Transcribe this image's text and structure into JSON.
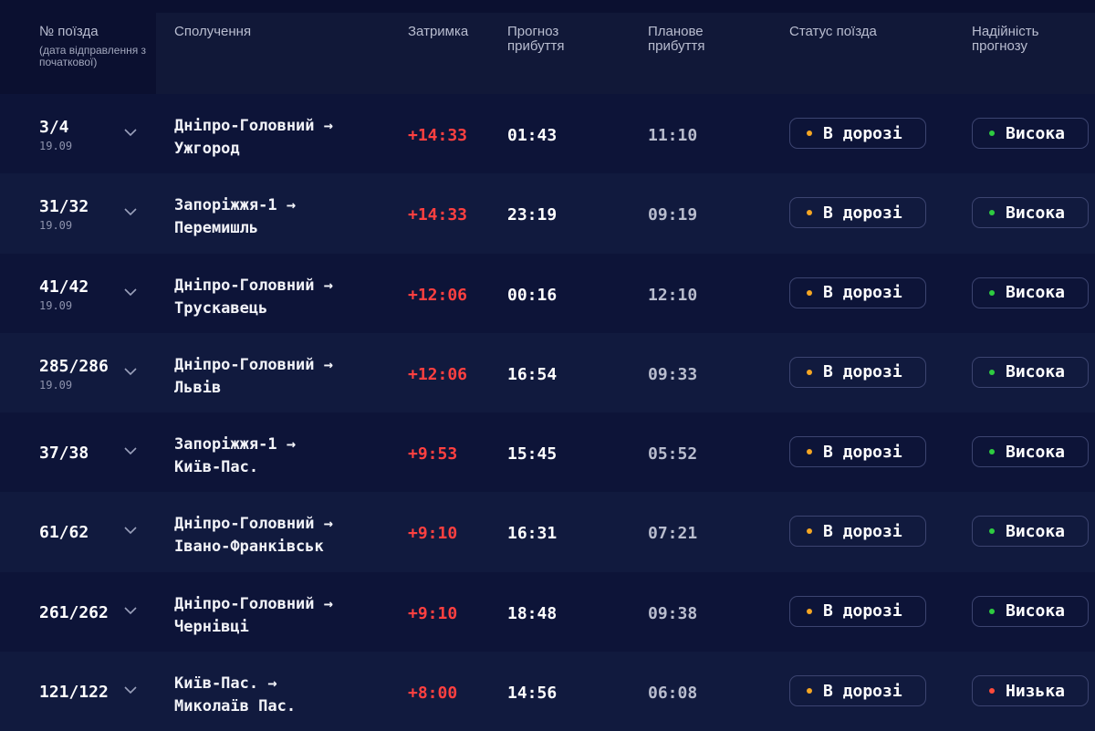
{
  "colors": {
    "status_dot": "#f5a623",
    "high_dot": "#2ecc40",
    "low_dot": "#ff4b3a",
    "delay": "#ff4040"
  },
  "header": {
    "train": "№ поїзда",
    "train_sub": "(дата відправлення з початкової)",
    "route": "Сполучення",
    "delay": "Затримка",
    "forecast": "Прогноз прибуття",
    "planned": "Планове прибуття",
    "status": "Статус поїзда",
    "reliability": "Надійність прогнозу"
  },
  "rows": [
    {
      "train": "3/4",
      "date": "19.09",
      "route_from": "Дніпро-Головний →",
      "route_to": "Ужгород",
      "delay": "+14:33",
      "forecast": "01:43",
      "planned": "11:10",
      "status": "В дорозі",
      "reliability": "Висока",
      "reliability_level": "high"
    },
    {
      "train": "31/32",
      "date": "19.09",
      "route_from": "Запоріжжя-1 →",
      "route_to": "Перемишль",
      "delay": "+14:33",
      "forecast": "23:19",
      "planned": "09:19",
      "status": "В дорозі",
      "reliability": "Висока",
      "reliability_level": "high"
    },
    {
      "train": "41/42",
      "date": "19.09",
      "route_from": "Дніпро-Головний →",
      "route_to": "Трускавець",
      "delay": "+12:06",
      "forecast": "00:16",
      "planned": "12:10",
      "status": "В дорозі",
      "reliability": "Висока",
      "reliability_level": "high"
    },
    {
      "train": "285/286",
      "date": "19.09",
      "route_from": "Дніпро-Головний →",
      "route_to": "Львів",
      "delay": "+12:06",
      "forecast": "16:54",
      "planned": "09:33",
      "status": "В дорозі",
      "reliability": "Висока",
      "reliability_level": "high"
    },
    {
      "train": "37/38",
      "date": "",
      "route_from": "Запоріжжя-1 →",
      "route_to": "Київ-Пас.",
      "delay": "+9:53",
      "forecast": "15:45",
      "planned": "05:52",
      "status": "В дорозі",
      "reliability": "Висока",
      "reliability_level": "high"
    },
    {
      "train": "61/62",
      "date": "",
      "route_from": "Дніпро-Головний →",
      "route_to": "Івано-Франківськ",
      "delay": "+9:10",
      "forecast": "16:31",
      "planned": "07:21",
      "status": "В дорозі",
      "reliability": "Висока",
      "reliability_level": "high"
    },
    {
      "train": "261/262",
      "date": "",
      "route_from": "Дніпро-Головний →",
      "route_to": "Чернівці",
      "delay": "+9:10",
      "forecast": "18:48",
      "planned": "09:38",
      "status": "В дорозі",
      "reliability": "Висока",
      "reliability_level": "high"
    },
    {
      "train": "121/122",
      "date": "",
      "route_from": "Київ-Пас. →",
      "route_to": "Миколаїв Пас.",
      "delay": "+8:00",
      "forecast": "14:56",
      "planned": "06:08",
      "status": "В дорозі",
      "reliability": "Низька",
      "reliability_level": "low"
    }
  ]
}
